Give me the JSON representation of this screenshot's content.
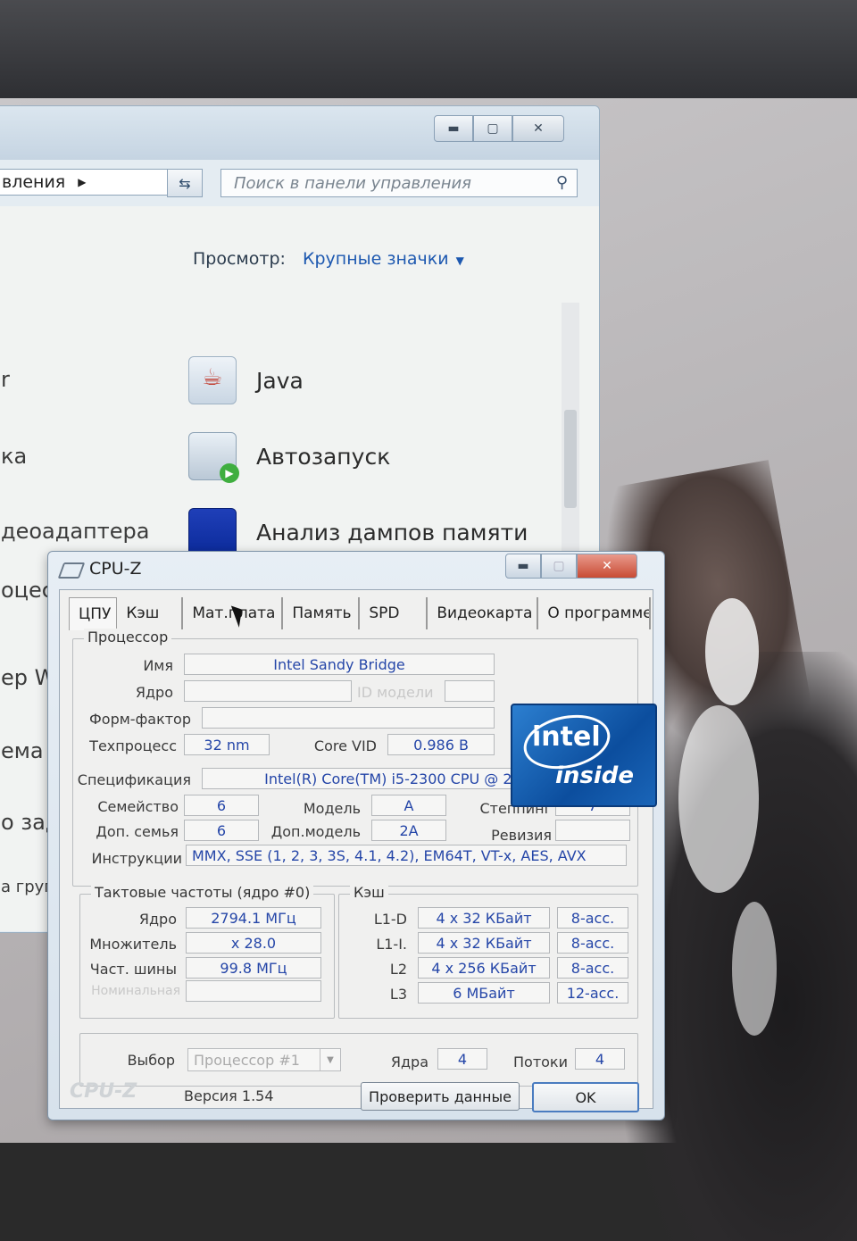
{
  "control_panel": {
    "address_text": "вления",
    "search_placeholder": "Поиск в панели управления",
    "view_label": "Просмотр:",
    "view_value": "Крупные значки",
    "items": [
      {
        "label": "Java",
        "icon": "java-icon"
      },
      {
        "label": "Автозапуск",
        "icon": "autoplay-icon"
      },
      {
        "label": "Анализ дампов памяти",
        "icon": "memory-dump-icon"
      }
    ],
    "left_fragments": [
      "r",
      "ка",
      "деоадаптера",
      "оцес",
      "ер Wi",
      "ема",
      "о зада",
      "а груп"
    ]
  },
  "cpuz": {
    "title": "CPU-Z",
    "tabs": [
      "ЦПУ",
      "Кэш",
      "Мат.плата",
      "Память",
      "SPD",
      "Видеокарта",
      "О программе"
    ],
    "processor": {
      "group_title": "Процессор",
      "name_label": "Имя",
      "name": "Intel Sandy Bridge",
      "core_label": "Ядро",
      "model_id_label": "ID модели",
      "form_factor_label": "Форм-фактор",
      "tech_label": "Техпроцесс",
      "tech": "32 nm",
      "vid_label": "Core VID",
      "vid": "0.986 В",
      "spec_label": "Спецификация",
      "spec": "Intel(R) Core(TM) i5-2300 CPU @ 2.80GHz",
      "family_label": "Семейство",
      "family": "6",
      "model_label": "Модель",
      "model": "A",
      "stepping_label": "Степпинг",
      "stepping": "7",
      "ext_family_label": "Доп. семья",
      "ext_family": "6",
      "ext_model_label": "Доп.модель",
      "ext_model": "2A",
      "revision_label": "Ревизия",
      "revision": "",
      "instr_label": "Инструкции",
      "instr": "MMX, SSE (1, 2, 3, 3S, 4.1, 4.2), EM64T, VT-x, AES, AVX"
    },
    "clocks": {
      "group_title": "Тактовые частоты (ядро #0)",
      "core_label": "Ядро",
      "core": "2794.1 МГц",
      "mult_label": "Множитель",
      "mult": "x 28.0",
      "bus_label": "Част. шины",
      "bus": "99.8 МГц",
      "rated_label": "Номинальная"
    },
    "cache": {
      "group_title": "Кэш",
      "rows": [
        {
          "level": "L1-D",
          "size": "4 x 32 КБайт",
          "assoc": "8-асс."
        },
        {
          "level": "L1-I.",
          "size": "4 x 32 КБайт",
          "assoc": "8-асс."
        },
        {
          "level": "L2",
          "size": "4 x 256 КБайт",
          "assoc": "8-асс."
        },
        {
          "level": "L3",
          "size": "6 МБайт",
          "assoc": "12-асс."
        }
      ]
    },
    "selection": {
      "label": "Выбор",
      "value": "Процессор #1",
      "cores_label": "Ядра",
      "cores": "4",
      "threads_label": "Потоки",
      "threads": "4"
    },
    "footer": {
      "brand": "CPU-Z",
      "version": "Версия 1.54",
      "validate": "Проверить данные",
      "ok": "OK"
    },
    "intel_logo": {
      "top": "intel",
      "bottom": "inside"
    }
  }
}
